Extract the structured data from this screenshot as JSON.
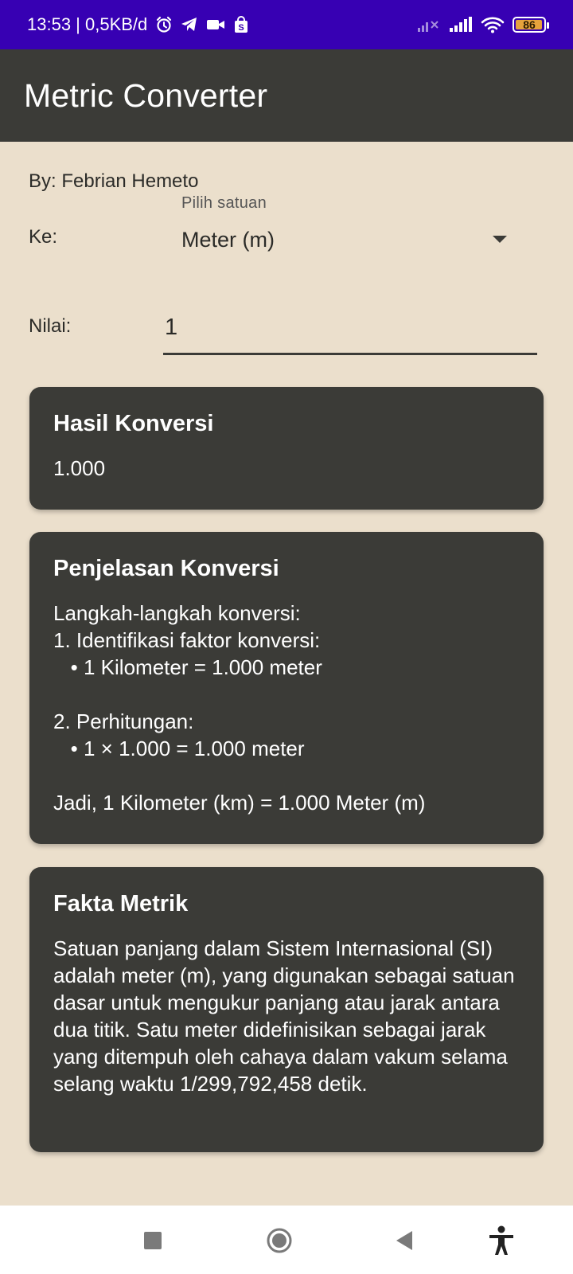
{
  "status_bar": {
    "time_info": "13:53 | 0,5KB/d",
    "battery": "86",
    "icons": [
      "alarm-icon",
      "telegram-icon",
      "video-icon",
      "shopee-icon",
      "signal-x-icon",
      "signal-icon",
      "wifi-icon",
      "battery-icon"
    ],
    "background": "#3700b3"
  },
  "app_bar": {
    "title": "Metric Converter",
    "background": "#3b3b37"
  },
  "author": "By: Febrian Hemeto",
  "to_field": {
    "label": "Ke:",
    "hint": "Pilih satuan",
    "value": "Meter (m)"
  },
  "value_field": {
    "label": "Nilai:",
    "value": "1"
  },
  "result_card": {
    "title": "Hasil Konversi",
    "value": "1.000"
  },
  "explanation_card": {
    "title": "Penjelasan Konversi",
    "text": "Langkah-langkah konversi:\n1. Identifikasi faktor konversi:\n   • 1 Kilometer = 1.000 meter\n\n2. Perhitungan:\n   • 1 × 1.000 = 1.000 meter\n\nJadi, 1 Kilometer (km) = 1.000 Meter (m)"
  },
  "fact_card": {
    "title": "Fakta Metrik",
    "text": "Satuan panjang dalam Sistem Internasional (SI) adalah meter (m), yang digunakan sebagai satuan dasar untuk mengukur panjang atau jarak antara dua titik. Satu meter didefinisikan sebagai jarak yang ditempuh oleh cahaya dalam vakum selama selang waktu 1/299,792,458 detik."
  },
  "nav_bar": {
    "icons": [
      "recents-icon",
      "home-icon",
      "back-icon",
      "accessibility-icon"
    ]
  },
  "colors": {
    "background": "#ebdfcc",
    "card": "#3b3b37",
    "text_dark": "#2b2b28",
    "battery_fill": "#e6a23c"
  }
}
